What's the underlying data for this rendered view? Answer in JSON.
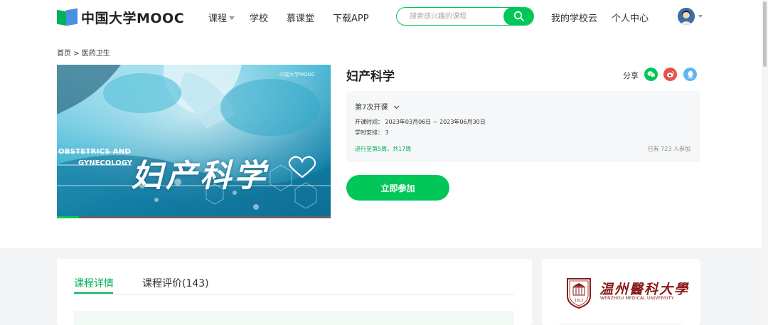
{
  "header": {
    "logo_text": "中国大学MOOC",
    "nav": [
      {
        "label": "课程"
      },
      {
        "label": "学校"
      },
      {
        "label": "慕课堂"
      },
      {
        "label": "下载APP"
      }
    ],
    "search_placeholder": "搜索感兴趣的课程",
    "my_school_cloud": "我的学校云",
    "personal_center": "个人中心"
  },
  "breadcrumb": {
    "home": "首页",
    "separator": ">",
    "category": "医药卫生"
  },
  "hero": {
    "watermark": "中国大学MOOC",
    "english_title_1": "OBSTETRICS AND",
    "english_title_2": "GYNECOLOGY",
    "chinese_title": "妇产科学",
    "video_progress": 0.08
  },
  "course": {
    "title": "妇产科学",
    "share_label": "分享",
    "session_label": "第7次开课",
    "schedule_label": "开课时间：",
    "schedule_value": "2023年03月06日 ~ 2023年06月30日",
    "hours_label": "学时安排：",
    "hours_value": "3",
    "progress_text": "进行至第5周，共17周",
    "participants_text": "已有 723 人参加",
    "join_button": "立即参加"
  },
  "tabs": [
    {
      "label": "课程详情"
    },
    {
      "label": "课程评价(143)"
    }
  ],
  "school": {
    "name_cn": "温州醫科大學",
    "name_en": "WENZHOU MEDICAL UNIVERSITY",
    "seal_year": "1912"
  },
  "colors": {
    "brand_green": "#00c758",
    "school_red": "#8b1a1a"
  },
  "icons": {
    "search": "search-icon",
    "wechat": "wechat-icon",
    "weibo": "weibo-icon",
    "qq": "qq-icon"
  }
}
